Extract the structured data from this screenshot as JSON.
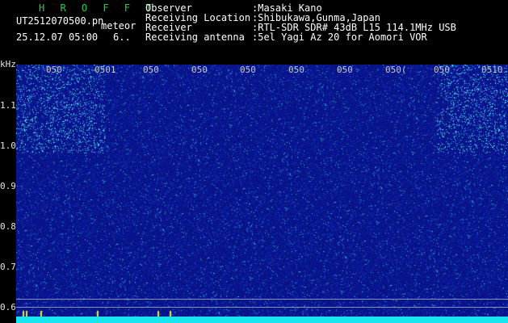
{
  "header": {
    "brand": "H R O F F T",
    "filename": "UT2512070500.pn",
    "subtitle": "meteor",
    "datetime": "25.12.07 05:00",
    "count": "6..",
    "labels": [
      "Observer",
      "Receiving Location",
      "Receiver",
      "Receiving antenna"
    ],
    "values": [
      ":Masaki Kano",
      ":Shibukawa,Gunma,Japan",
      ":RTL-SDR SDR# 43dB L15 114.1MHz USB",
      ":5el Yagi Az 20 for Aomori VOR"
    ]
  },
  "axis": {
    "unit": "kHz",
    "ticks": [
      "1.1",
      "1.0",
      "0.9",
      "0.8",
      "0.7",
      "0.6"
    ]
  },
  "time_labels": [
    "050",
    "0501",
    "050",
    "050",
    "050",
    "050",
    "050",
    "050",
    "050(",
    "050",
    "0510"
  ],
  "colors": {
    "background": "#000000",
    "waterfall_base": "#0a1890",
    "brand": "#22d04a",
    "bottom_band": "#17e6f0"
  }
}
